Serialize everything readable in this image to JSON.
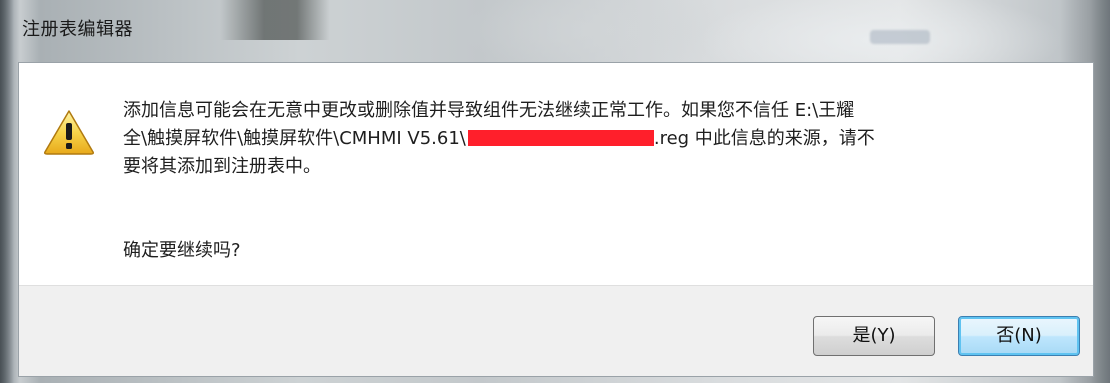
{
  "window": {
    "title": "注册表编辑器"
  },
  "dialog": {
    "icon": "warning-icon",
    "message_lines": [
      "添加信息可能会在无意中更改或删除值并导致组件无法继续正常工作。如果您不信任 E:\\王耀",
      "全\\触摸屏软件\\触摸屏软件\\CMHMI V5.61\\",
      ".reg 中此信息的来源，请不",
      "要将其添加到注册表中。"
    ],
    "confirm_text": "确定要继续吗?",
    "buttons": {
      "yes_label": "是(Y)",
      "no_label": "否(N)"
    },
    "colors": {
      "redaction": "#ff1f2b",
      "focus_border": "#3c7fb1"
    }
  }
}
